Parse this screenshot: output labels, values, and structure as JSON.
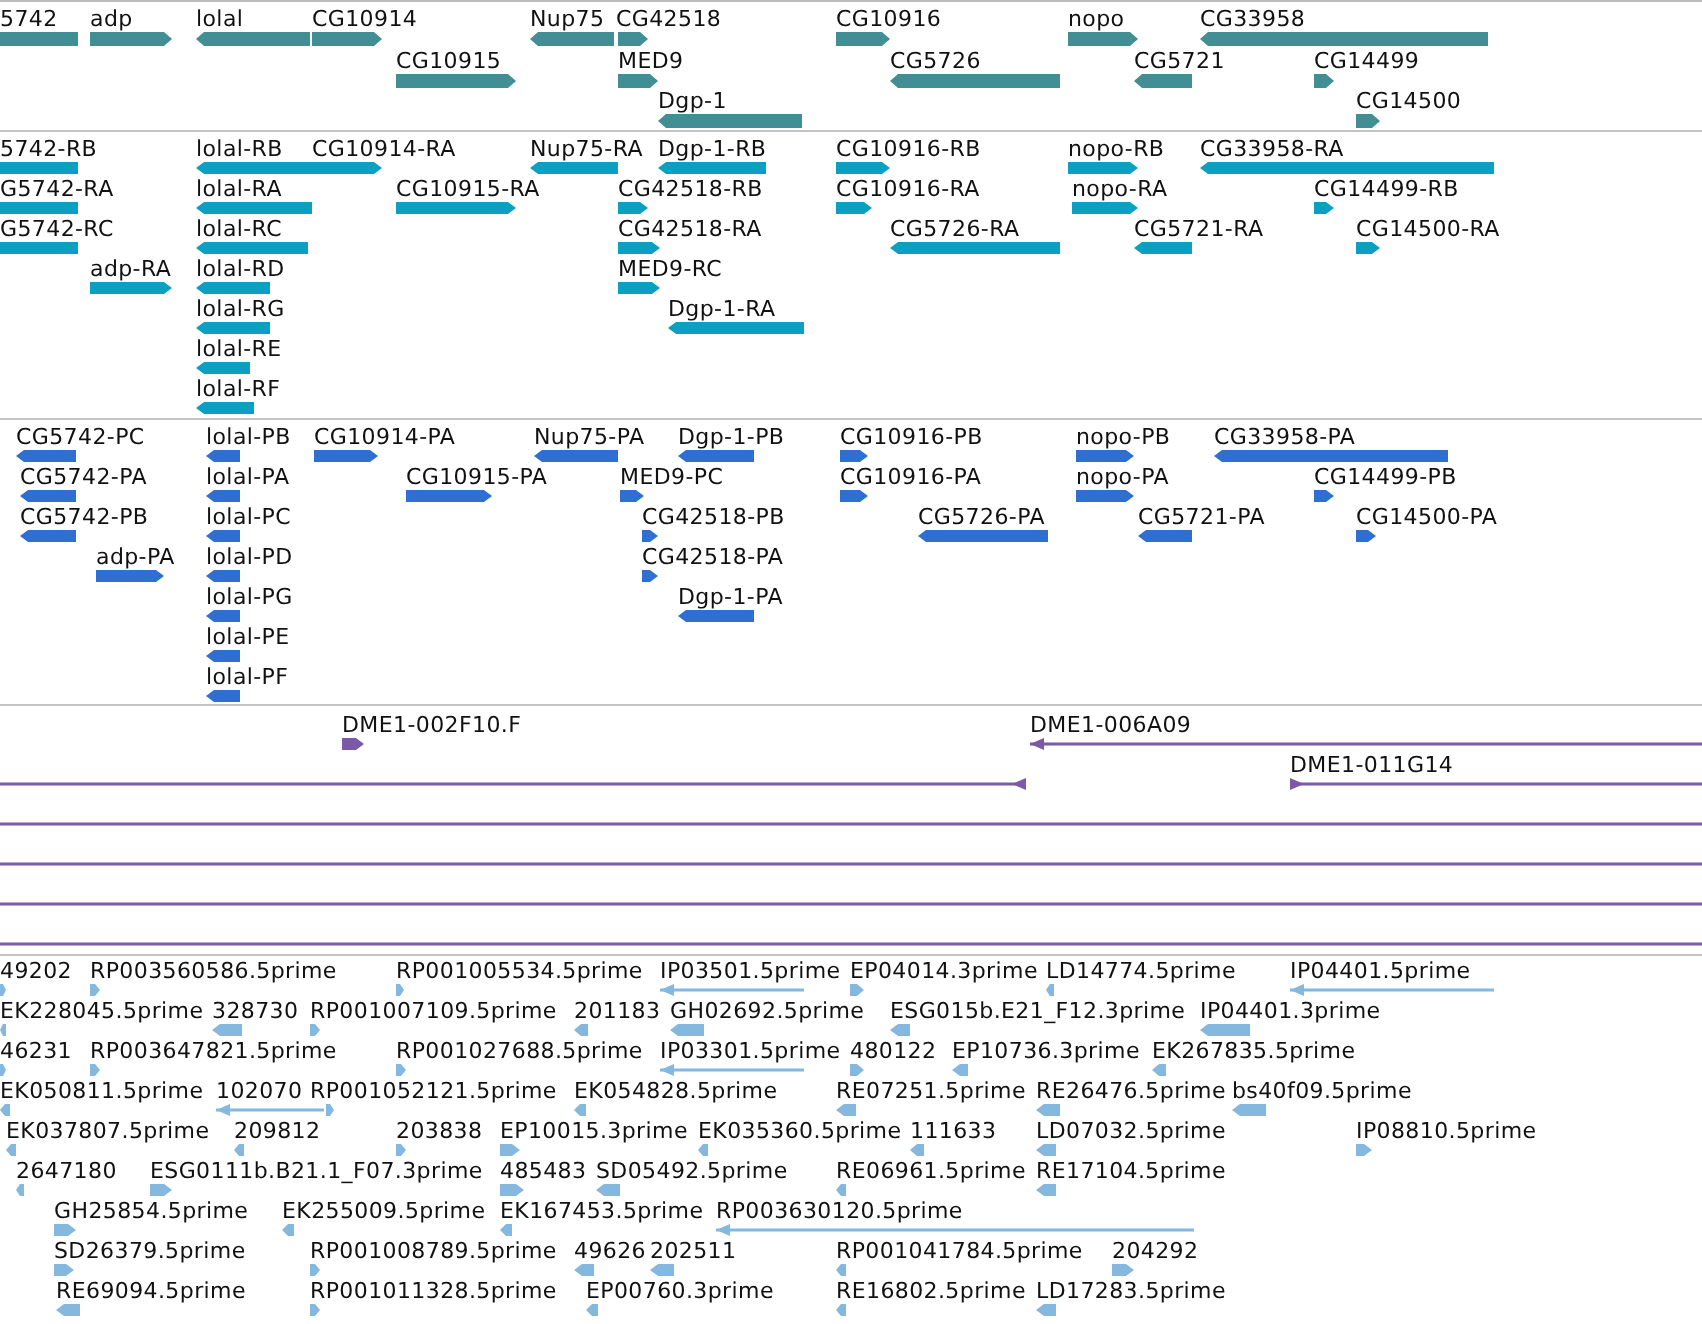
{
  "tracks": [
    {
      "kind": "gene",
      "features": [
        {
          "label": "5742",
          "reverse": true
        },
        {
          "label": "adp",
          "reverse": false
        },
        {
          "label": "lolal",
          "reverse": true
        },
        {
          "label": "CG10914",
          "reverse": false
        },
        {
          "label": "Nup75",
          "reverse": true
        },
        {
          "label": "CG42518",
          "reverse": false
        },
        {
          "label": "CG10916",
          "reverse": false
        },
        {
          "label": "nopo",
          "reverse": false
        },
        {
          "label": "CG33958",
          "reverse": true
        },
        {
          "label": "CG10915",
          "reverse": false
        },
        {
          "label": "MED9",
          "reverse": false
        },
        {
          "label": "CG5726",
          "reverse": true
        },
        {
          "label": "CG5721",
          "reverse": true
        },
        {
          "label": "CG14499",
          "reverse": false
        },
        {
          "label": "Dgp-1",
          "reverse": true
        },
        {
          "label": "CG14500",
          "reverse": false
        }
      ]
    },
    {
      "kind": "mrna",
      "features": [
        {
          "label": "5742-RB",
          "reverse": true
        },
        {
          "label": "lolal-RB",
          "reverse": true
        },
        {
          "label": "CG10914-RA",
          "reverse": false
        },
        {
          "label": "Nup75-RA",
          "reverse": true
        },
        {
          "label": "Dgp-1-RB",
          "reverse": true
        },
        {
          "label": "CG10916-RB",
          "reverse": false
        },
        {
          "label": "nopo-RB",
          "reverse": false
        },
        {
          "label": "CG33958-RA",
          "reverse": true
        },
        {
          "label": "G5742-RA",
          "reverse": true
        },
        {
          "label": "lolal-RA",
          "reverse": true
        },
        {
          "label": "CG10915-RA",
          "reverse": false
        },
        {
          "label": "CG42518-RB",
          "reverse": false
        },
        {
          "label": "CG10916-RA",
          "reverse": false
        },
        {
          "label": "nopo-RA",
          "reverse": false
        },
        {
          "label": "CG14499-RB",
          "reverse": false
        },
        {
          "label": "G5742-RC",
          "reverse": true
        },
        {
          "label": "lolal-RC",
          "reverse": true
        },
        {
          "label": "CG42518-RA",
          "reverse": false
        },
        {
          "label": "CG5726-RA",
          "reverse": true
        },
        {
          "label": "CG5721-RA",
          "reverse": true
        },
        {
          "label": "CG14500-RA",
          "reverse": false
        },
        {
          "label": "adp-RA",
          "reverse": false
        },
        {
          "label": "lolal-RD",
          "reverse": true
        },
        {
          "label": "MED9-RC",
          "reverse": false
        },
        {
          "label": "lolal-RG",
          "reverse": true
        },
        {
          "label": "Dgp-1-RA",
          "reverse": true
        },
        {
          "label": "lolal-RE",
          "reverse": true
        },
        {
          "label": "lolal-RF",
          "reverse": true
        }
      ]
    },
    {
      "kind": "protein",
      "features": [
        {
          "label": "CG5742-PC",
          "reverse": true
        },
        {
          "label": "lolal-PB",
          "reverse": true
        },
        {
          "label": "CG10914-PA",
          "reverse": false
        },
        {
          "label": "Nup75-PA",
          "reverse": true
        },
        {
          "label": "Dgp-1-PB",
          "reverse": true
        },
        {
          "label": "CG10916-PB",
          "reverse": false
        },
        {
          "label": "nopo-PB",
          "reverse": false
        },
        {
          "label": "CG33958-PA",
          "reverse": true
        },
        {
          "label": "CG5742-PA",
          "reverse": true
        },
        {
          "label": "lolal-PA",
          "reverse": true
        },
        {
          "label": "CG10915-PA",
          "reverse": false
        },
        {
          "label": "MED9-PC",
          "reverse": false
        },
        {
          "label": "CG10916-PA",
          "reverse": false
        },
        {
          "label": "nopo-PA",
          "reverse": false
        },
        {
          "label": "CG14499-PB",
          "reverse": false
        },
        {
          "label": "CG5742-PB",
          "reverse": true
        },
        {
          "label": "lolal-PC",
          "reverse": true
        },
        {
          "label": "CG42518-PB",
          "reverse": false
        },
        {
          "label": "CG5726-PA",
          "reverse": true
        },
        {
          "label": "CG5721-PA",
          "reverse": true
        },
        {
          "label": "CG14500-PA",
          "reverse": false
        },
        {
          "label": "adp-PA",
          "reverse": false
        },
        {
          "label": "lolal-PD",
          "reverse": true
        },
        {
          "label": "CG42518-PA",
          "reverse": false
        },
        {
          "label": "lolal-PG",
          "reverse": true
        },
        {
          "label": "Dgp-1-PA",
          "reverse": true
        },
        {
          "label": "lolal-PE",
          "reverse": true
        },
        {
          "label": "lolal-PF",
          "reverse": true
        }
      ]
    },
    {
      "kind": "clone",
      "features": [
        {
          "kind": "end",
          "label": "DME1-002F10.F",
          "reverse": false
        },
        {
          "kind": "end",
          "label": "DME1-006A09",
          "reverse": true
        },
        {
          "kind": "end",
          "reverse": true
        },
        {
          "kind": "end",
          "label": "DME1-011G14",
          "reverse": false
        },
        {
          "kind": "span"
        },
        {
          "kind": "span"
        },
        {
          "kind": "span"
        },
        {
          "kind": "span"
        }
      ]
    },
    {
      "kind": "est",
      "features": [
        {
          "label": "49202",
          "reverse": false
        },
        {
          "label": "RP003560586.5prime",
          "reverse": false
        },
        {
          "label": "RP001005534.5prime",
          "reverse": false
        },
        {
          "label": "IP03501.5prime",
          "reverse": true
        },
        {
          "label": "EP04014.3prime",
          "reverse": false
        },
        {
          "label": "LD14774.5prime",
          "reverse": true
        },
        {
          "label": "IP04401.5prime",
          "reverse": true
        },
        {
          "label": "EK228045.5prime",
          "reverse": true
        },
        {
          "label": "328730",
          "reverse": true
        },
        {
          "label": "RP001007109.5prime",
          "reverse": false
        },
        {
          "label": "201183",
          "reverse": true
        },
        {
          "label": "GH02692.5prime",
          "reverse": true
        },
        {
          "label": "ESG015b.E21_F12.3prime",
          "reverse": true
        },
        {
          "label": "IP04401.3prime",
          "reverse": true
        },
        {
          "label": "46231",
          "reverse": false
        },
        {
          "label": "RP003647821.5prime",
          "reverse": false
        },
        {
          "label": "RP001027688.5prime",
          "reverse": false
        },
        {
          "label": "IP03301.5prime",
          "reverse": true
        },
        {
          "label": "480122",
          "reverse": false
        },
        {
          "label": "EP10736.3prime",
          "reverse": true
        },
        {
          "label": "EK267835.5prime",
          "reverse": true
        },
        {
          "label": "EK050811.5prime",
          "reverse": true
        },
        {
          "label": "102070",
          "reverse": true
        },
        {
          "label": "RP001052121.5prime",
          "reverse": false
        },
        {
          "label": "EK054828.5prime",
          "reverse": true
        },
        {
          "label": "RE07251.5prime",
          "reverse": true
        },
        {
          "label": "RE26476.5prime",
          "reverse": true
        },
        {
          "label": "bs40f09.5prime",
          "reverse": true
        },
        {
          "label": "EK037807.5prime",
          "reverse": true
        },
        {
          "label": "209812",
          "reverse": true
        },
        {
          "label": "203838",
          "reverse": false
        },
        {
          "label": "EP10015.3prime",
          "reverse": false
        },
        {
          "label": "EK035360.5prime",
          "reverse": true
        },
        {
          "label": "111633",
          "reverse": true
        },
        {
          "label": "LD07032.5prime",
          "reverse": true
        },
        {
          "label": "IP08810.5prime",
          "reverse": false
        },
        {
          "label": "2647180",
          "reverse": true
        },
        {
          "label": "ESG0111b.B21.1_F07.3prime",
          "reverse": false
        },
        {
          "label": "485483",
          "reverse": false
        },
        {
          "label": "SD05492.5prime",
          "reverse": true
        },
        {
          "label": "RE06961.5prime",
          "reverse": true
        },
        {
          "label": "RE17104.5prime",
          "reverse": true
        },
        {
          "label": "GH25854.5prime",
          "reverse": false
        },
        {
          "label": "EK255009.5prime",
          "reverse": true
        },
        {
          "label": "EK167453.5prime",
          "reverse": true
        },
        {
          "label": "RP003630120.5prime",
          "reverse": true
        },
        {
          "label": "SD26379.5prime",
          "reverse": false
        },
        {
          "label": "RP001008789.5prime",
          "reverse": false
        },
        {
          "label": "49626",
          "reverse": true
        },
        {
          "label": "202511",
          "reverse": true
        },
        {
          "label": "RP001041784.5prime",
          "reverse": true
        },
        {
          "label": "204292",
          "reverse": false
        },
        {
          "label": "RE69094.5prime",
          "reverse": true
        },
        {
          "label": "RP001011328.5prime",
          "reverse": false
        },
        {
          "label": "EP00760.3prime",
          "reverse": true
        },
        {
          "label": "RE16802.5prime",
          "reverse": true
        },
        {
          "label": "LD17283.5prime",
          "reverse": true
        }
      ]
    }
  ]
}
